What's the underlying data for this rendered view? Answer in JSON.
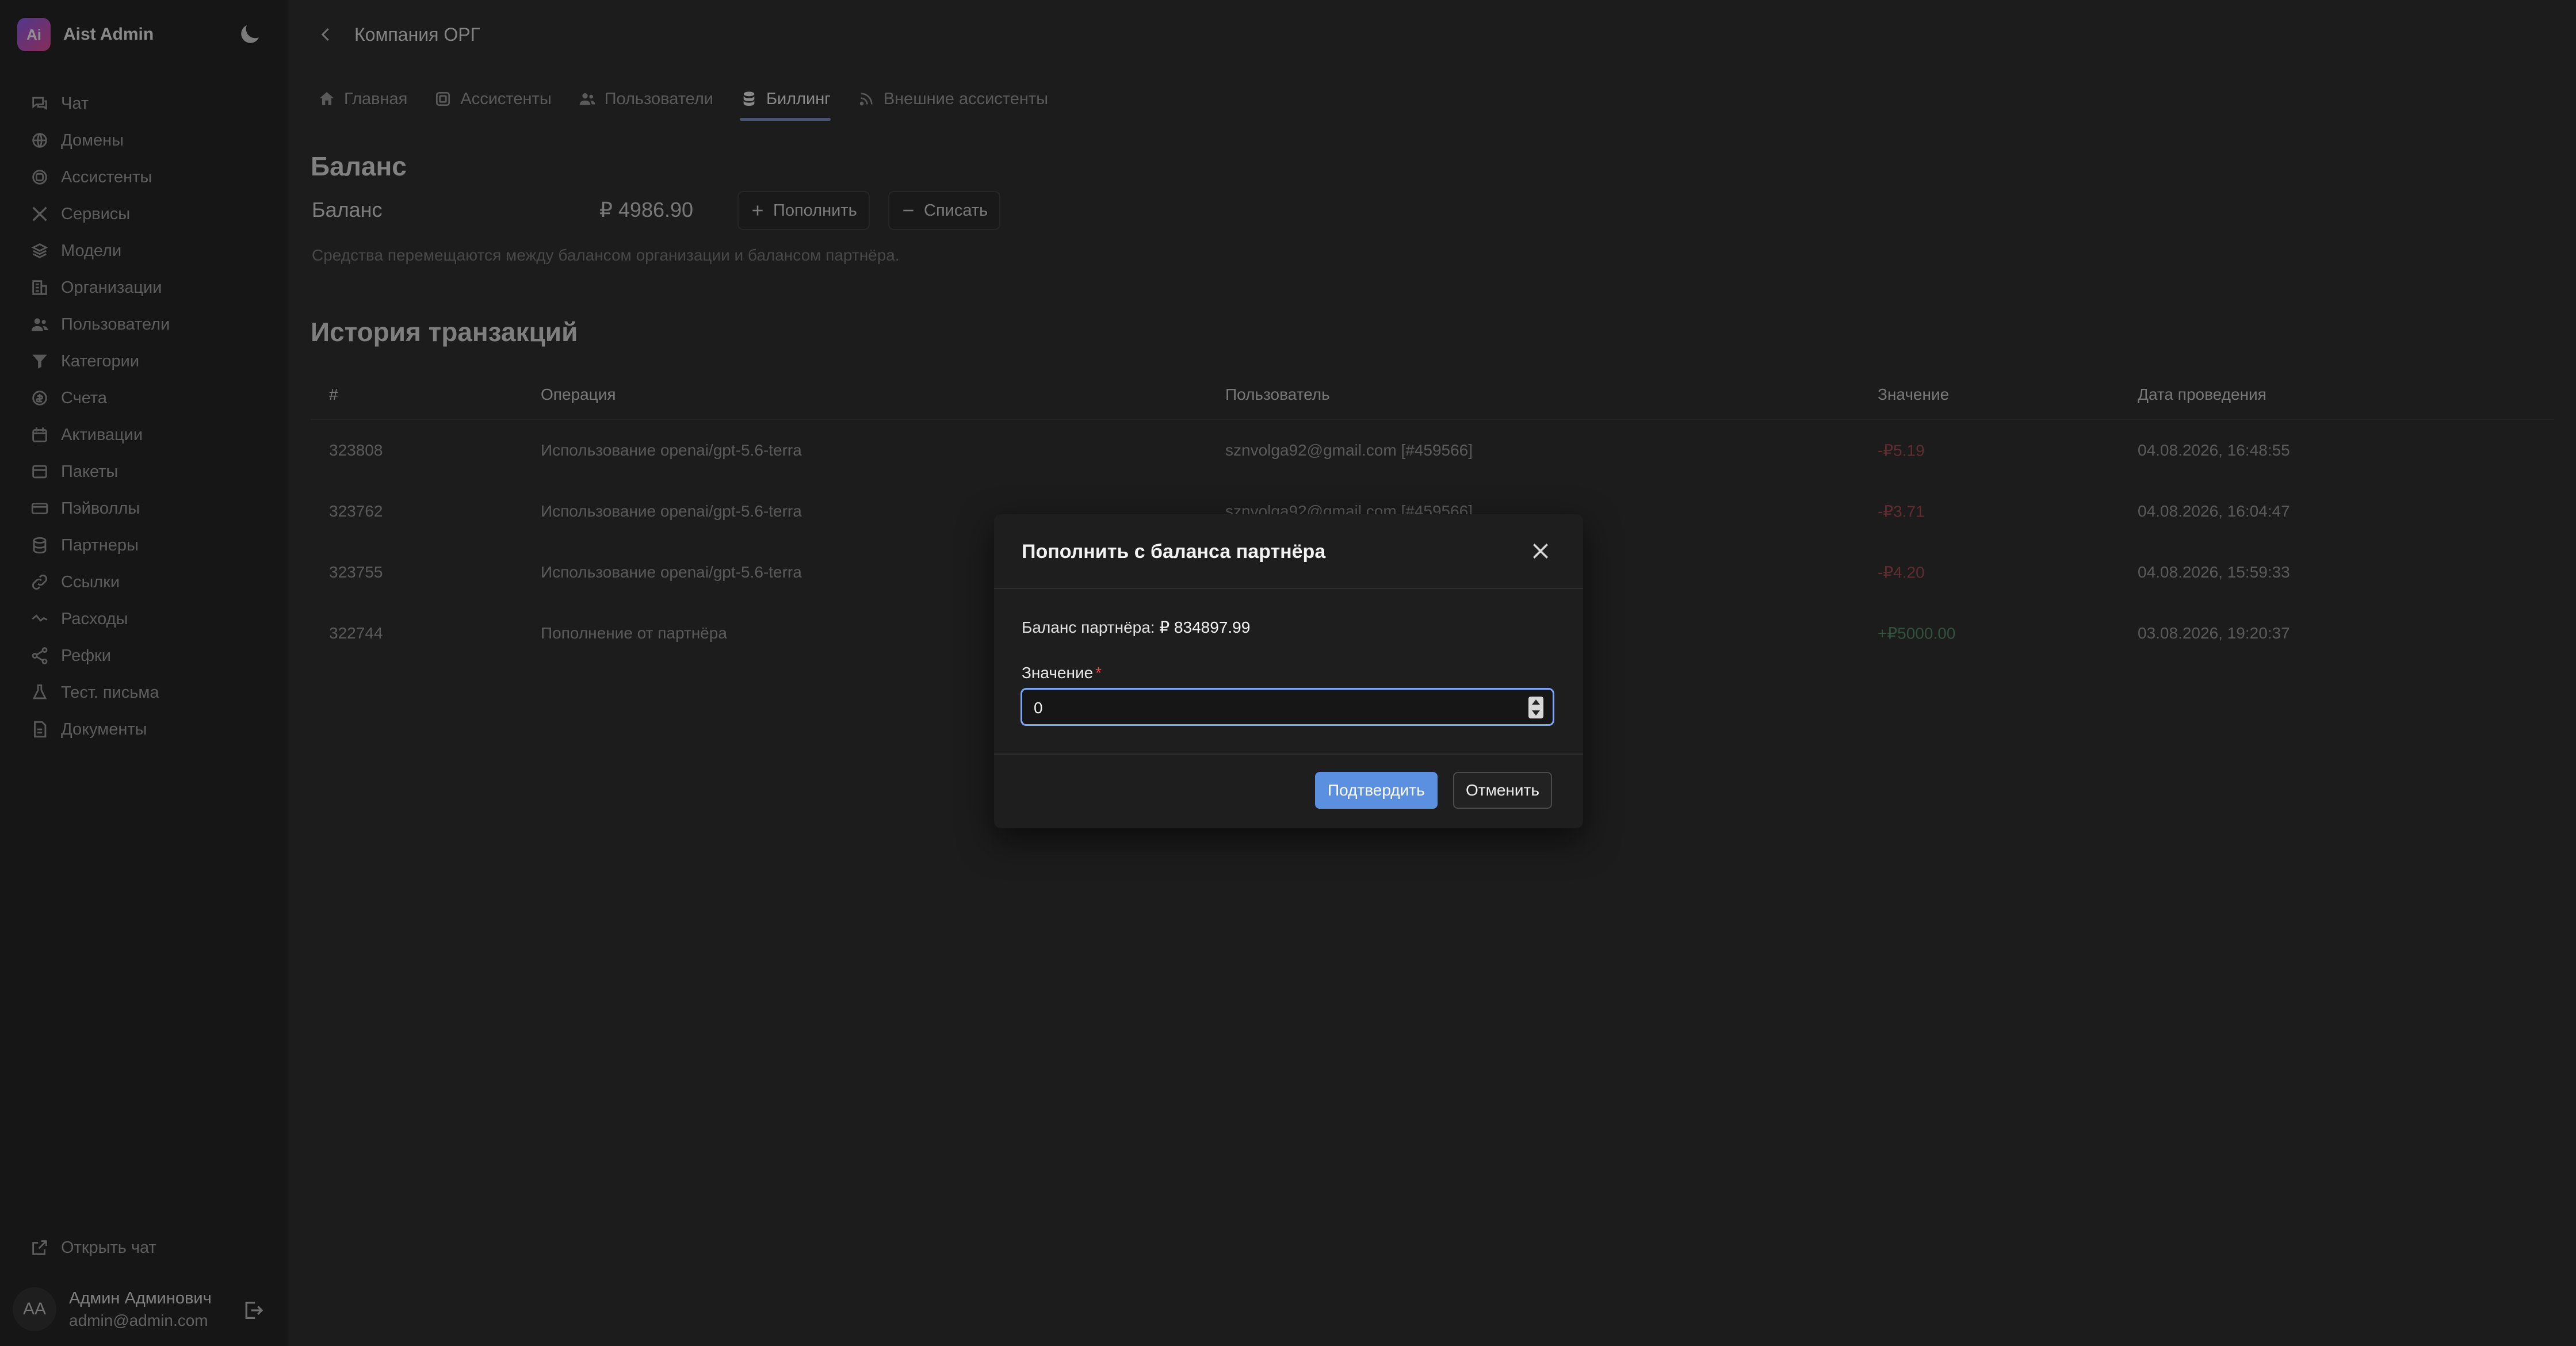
{
  "brand": {
    "logo_text": "Ai",
    "name": "Aist Admin"
  },
  "sidebar": {
    "items": [
      {
        "label": "Чат",
        "icon": "chat-icon"
      },
      {
        "label": "Домены",
        "icon": "domains-icon"
      },
      {
        "label": "Ассистенты",
        "icon": "assistant-icon"
      },
      {
        "label": "Сервисы",
        "icon": "tools-icon"
      },
      {
        "label": "Модели",
        "icon": "layers-icon"
      },
      {
        "label": "Организации",
        "icon": "building-icon"
      },
      {
        "label": "Пользователи",
        "icon": "users-icon"
      },
      {
        "label": "Категории",
        "icon": "filter-icon"
      },
      {
        "label": "Счета",
        "icon": "coin-icon"
      },
      {
        "label": "Активации",
        "icon": "calendar-icon"
      },
      {
        "label": "Пакеты",
        "icon": "package-icon"
      },
      {
        "label": "Пэйволлы",
        "icon": "card-icon"
      },
      {
        "label": "Партнеры",
        "icon": "database-icon"
      },
      {
        "label": "Ссылки",
        "icon": "link-icon"
      },
      {
        "label": "Расходы",
        "icon": "trend-icon"
      },
      {
        "label": "Рефки",
        "icon": "share-icon"
      },
      {
        "label": "Тест. письма",
        "icon": "flask-icon"
      },
      {
        "label": "Документы",
        "icon": "document-icon"
      }
    ],
    "open_chat": "Открыть чат",
    "user": {
      "initials": "AA",
      "name": "Админ Админович",
      "email": "admin@admin.com"
    }
  },
  "header": {
    "title": "Компания ОРГ"
  },
  "tabs": [
    {
      "label": "Главная",
      "icon": "home-icon"
    },
    {
      "label": "Ассистенты",
      "icon": "assistant-icon"
    },
    {
      "label": "Пользователи",
      "icon": "users-icon"
    },
    {
      "label": "Биллинг",
      "icon": "database-icon",
      "active": true
    },
    {
      "label": "Внешние ассистенты",
      "icon": "rss-icon"
    }
  ],
  "balance": {
    "heading": "Баланс",
    "label": "Баланс",
    "value": "₽ 4986.90",
    "topup_label": "Пополнить",
    "withdraw_label": "Списать",
    "note": "Средства перемещаются между балансом организации и балансом партнёра."
  },
  "history": {
    "heading": "История транзакций",
    "columns": [
      "#",
      "Операция",
      "Пользователь",
      "Значение",
      "Дата проведения"
    ],
    "rows": [
      {
        "id": "323808",
        "operation": "Использование openai/gpt-5.6-terra",
        "user": "sznvolga92@gmail.com [#459566]",
        "value": "-₽5.19",
        "date": "04.08.2026, 16:48:55"
      },
      {
        "id": "323762",
        "operation": "Использование openai/gpt-5.6-terra",
        "user": "sznvolga92@gmail.com [#459566]",
        "value": "-₽3.71",
        "date": "04.08.2026, 16:04:47"
      },
      {
        "id": "323755",
        "operation": "Использование openai/gpt-5.6-terra",
        "user": "",
        "value": "-₽4.20",
        "date": "04.08.2026, 15:59:33"
      },
      {
        "id": "322744",
        "operation": "Пополнение от партнёра",
        "user": "",
        "value": "+₽5000.00",
        "date": "03.08.2026, 19:20:37"
      }
    ]
  },
  "modal": {
    "title": "Пополнить с баланса партнёра",
    "partner_balance_label": "Баланс партнёра:",
    "partner_balance_value": "₽ 834897.99",
    "field_label": "Значение",
    "required_mark": "*",
    "field_value": "0",
    "confirm_label": "Подтвердить",
    "cancel_label": "Отменить"
  },
  "colors": {
    "accent": "#5b8fe0",
    "negative": "#a8474f",
    "positive": "#4f8a64",
    "focus": "#7ea6f2"
  }
}
